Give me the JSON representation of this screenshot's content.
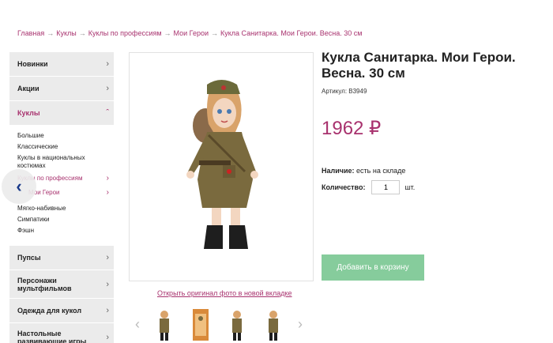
{
  "breadcrumb": {
    "items": [
      "Главная",
      "Куклы",
      "Куклы по профессиям",
      "Мои Герои",
      "Кукла Санитарка. Мои Герои. Весна. 30 см"
    ],
    "separator": "→"
  },
  "sidebar": {
    "categories_top": [
      {
        "label": "Новинки",
        "icon": "chevron-right"
      },
      {
        "label": "Акции",
        "icon": "chevron-right"
      },
      {
        "label": "Куклы",
        "icon": "chevron-up"
      }
    ],
    "dolls_sub": [
      "Большие",
      "Классические",
      "Куклы в национальных костюмах",
      "Куклы по профессиям",
      "Мои Герои",
      "Мягко-набивные",
      "Симпатики",
      "Фэшн"
    ],
    "categories_bottom": [
      {
        "label": "Пупсы",
        "icon": "chevron-right"
      },
      {
        "label": "Персонажи мультфильмов",
        "icon": "chevron-right"
      },
      {
        "label": "Одежда для кукол",
        "icon": "chevron-right"
      },
      {
        "label": "Настольные развивающие игры",
        "icon": "chevron-right"
      }
    ]
  },
  "product": {
    "title": "Кукла Санитарка. Мои Герои. Весна. 30 см",
    "sku": "Артикул: В3949",
    "price": "1962 ₽",
    "availability_label": "Наличие:",
    "availability_value": "есть на складе",
    "quantity_label": "Количество:",
    "quantity_value": "1",
    "quantity_unit": "шт.",
    "add_to_cart": "Добавить в корзину",
    "open_photo": "Открыть оригинал фото в новой вкладке"
  },
  "colors": {
    "accent": "#a8326e",
    "cart_button": "#86cc9c",
    "sidebar_bg": "#ebebeb"
  }
}
